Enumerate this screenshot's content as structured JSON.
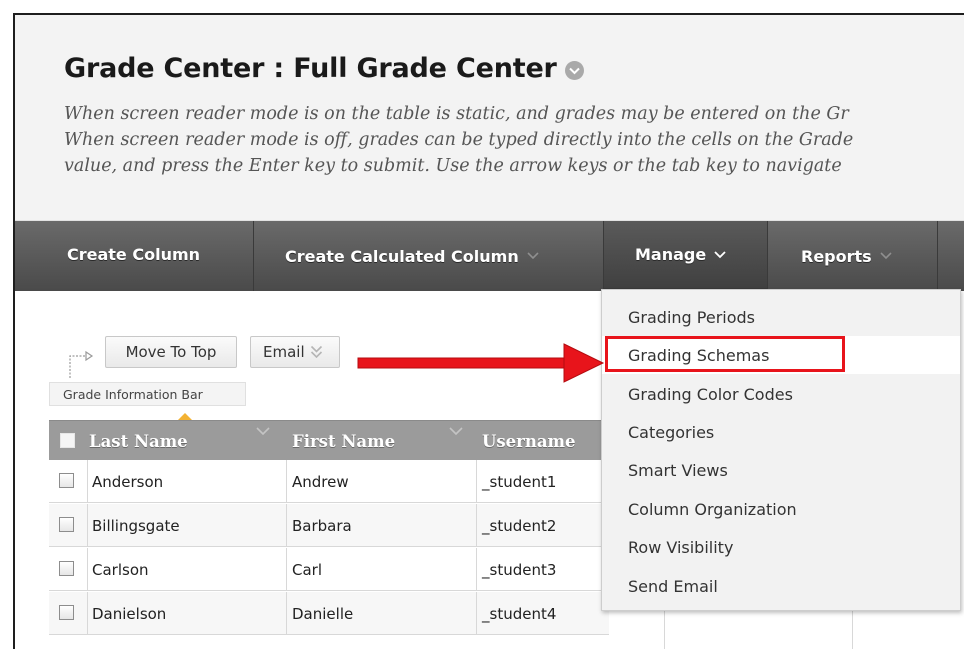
{
  "header": {
    "title": "Grade Center : Full Grade Center",
    "description": [
      "When screen reader mode is on the table is static, and grades may be entered on the Gr",
      "When screen reader mode is off, grades can be typed directly into the cells on the Grade",
      "value, and press the Enter key to submit. Use the arrow keys or the tab key to navigate"
    ]
  },
  "toolbar": {
    "create_column": "Create Column",
    "create_calculated_column": "Create Calculated Column",
    "manage": "Manage",
    "reports": "Reports"
  },
  "actions": {
    "move_to_top": "Move To Top",
    "email": "Email"
  },
  "info_bar": "Grade Information Bar",
  "table": {
    "columns": [
      "Last Name",
      "First Name",
      "Username"
    ],
    "rows": [
      {
        "last": "Anderson",
        "first": "Andrew",
        "username": "_student1"
      },
      {
        "last": "Billingsgate",
        "first": "Barbara",
        "username": "_student2"
      },
      {
        "last": "Carlson",
        "first": "Carl",
        "username": "_student3"
      },
      {
        "last": "Danielson",
        "first": "Danielle",
        "username": "_student4"
      }
    ]
  },
  "manage_menu": {
    "items": [
      "Grading Periods",
      "Grading Schemas",
      "Grading Color Codes",
      "Categories",
      "Smart Views",
      "Column Organization",
      "Row Visibility",
      "Send Email"
    ],
    "highlighted": "Grading Schemas"
  },
  "colors": {
    "highlight_red": "#e8141b",
    "toolbar_gray": "#555555",
    "header_bg": "#f3f3f3",
    "table_header": "#9b9b9b",
    "info_marker": "#f3b233"
  }
}
